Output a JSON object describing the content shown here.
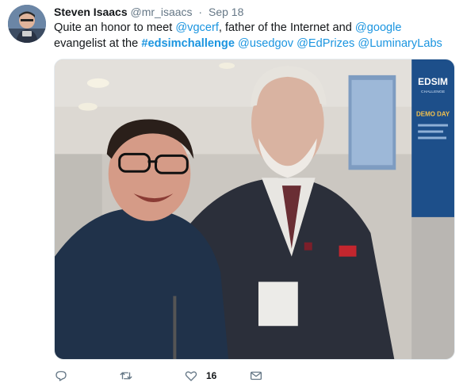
{
  "tweet": {
    "author_name": "Steven Isaacs",
    "handle": "@mr_isaacs",
    "separator": "·",
    "timestamp": "Sep 18",
    "text_parts": [
      {
        "type": "text",
        "value": "Quite an honor to meet "
      },
      {
        "type": "mention",
        "value": "@vgcerf"
      },
      {
        "type": "text",
        "value": ", father of the Internet and "
      },
      {
        "type": "mention",
        "value": "@google"
      },
      {
        "type": "text",
        "value": " evangelist at the "
      },
      {
        "type": "hashtag",
        "value": "#edsimchallenge"
      },
      {
        "type": "text",
        "value": " "
      },
      {
        "type": "mention",
        "value": "@usedgov"
      },
      {
        "type": "text",
        "value": " "
      },
      {
        "type": "mention",
        "value": "@EdPrizes"
      },
      {
        "type": "text",
        "value": " "
      },
      {
        "type": "mention",
        "value": "@LuminaryLabs"
      }
    ],
    "banner_texts": {
      "brand": "EDSIM",
      "sub": "CHALLENGE",
      "demo": "DEMO DAY"
    },
    "actions": {
      "reply_icon": "reply-icon",
      "retweet_icon": "retweet-icon",
      "like_icon": "heart-icon",
      "like_count": "16",
      "dm_icon": "envelope-icon"
    },
    "colors": {
      "link": "#1b95e0",
      "muted": "#657786",
      "text": "#14171a"
    }
  }
}
